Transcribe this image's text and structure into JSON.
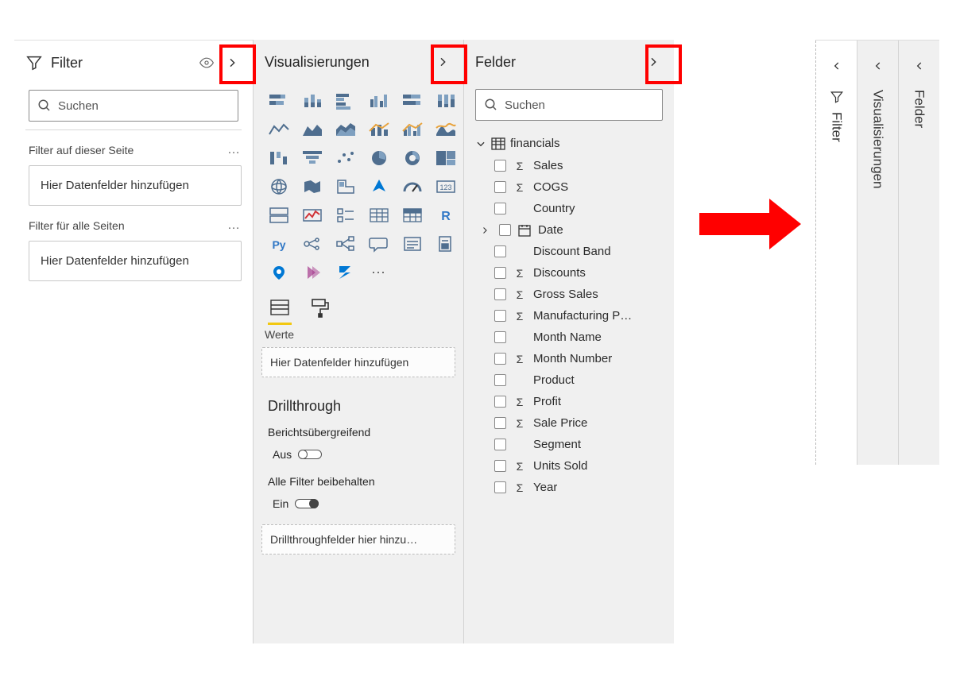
{
  "filter": {
    "title": "Filter",
    "search_placeholder": "Suchen",
    "section_page": "Filter auf dieser Seite",
    "section_all": "Filter für alle Seiten",
    "dropzone": "Hier Datenfelder hinzufügen"
  },
  "viz": {
    "title": "Visualisierungen",
    "values_label": "Werte",
    "dropzone": "Hier Datenfelder hinzufügen",
    "drillthrough": "Drillthrough",
    "cross_report": "Berichtsübergreifend",
    "off": "Aus",
    "keep_filters": "Alle Filter beibehalten",
    "on": "Ein",
    "drill_dropzone": "Drillthroughfelder hier hinzu…"
  },
  "fields": {
    "title": "Felder",
    "search_placeholder": "Suchen",
    "table": "financials",
    "items": [
      {
        "name": "Sales",
        "sigma": true,
        "expandable": false
      },
      {
        "name": "COGS",
        "sigma": true,
        "expandable": false
      },
      {
        "name": "Country",
        "sigma": false,
        "expandable": false
      },
      {
        "name": "Date",
        "sigma": false,
        "expandable": true,
        "calendar": true
      },
      {
        "name": "Discount Band",
        "sigma": false,
        "expandable": false
      },
      {
        "name": "Discounts",
        "sigma": true,
        "expandable": false
      },
      {
        "name": "Gross Sales",
        "sigma": true,
        "expandable": false
      },
      {
        "name": "Manufacturing P…",
        "sigma": true,
        "expandable": false
      },
      {
        "name": "Month Name",
        "sigma": false,
        "expandable": false
      },
      {
        "name": "Month Number",
        "sigma": true,
        "expandable": false
      },
      {
        "name": "Product",
        "sigma": false,
        "expandable": false
      },
      {
        "name": "Profit",
        "sigma": true,
        "expandable": false
      },
      {
        "name": "Sale Price",
        "sigma": true,
        "expandable": false
      },
      {
        "name": "Segment",
        "sigma": false,
        "expandable": false
      },
      {
        "name": "Units Sold",
        "sigma": true,
        "expandable": false
      },
      {
        "name": "Year",
        "sigma": true,
        "expandable": false
      }
    ]
  },
  "collapsed": {
    "filter": "Filter",
    "viz": "Visualisierungen",
    "fields": "Felder"
  }
}
